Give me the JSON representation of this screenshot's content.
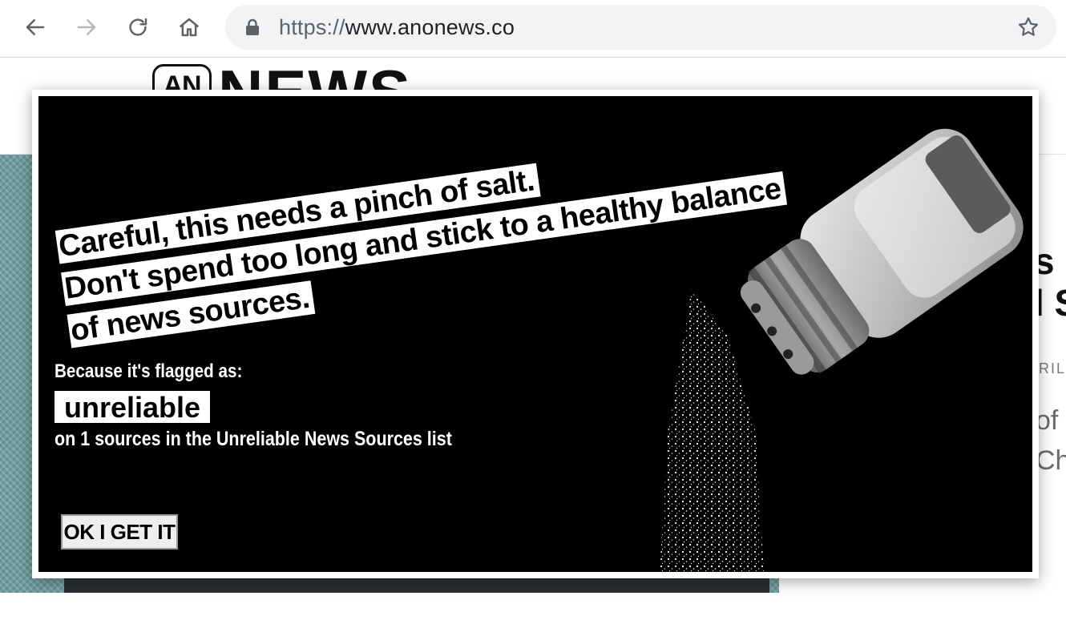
{
  "browser": {
    "url_scheme": "https://",
    "url_host": "www.anonews.co"
  },
  "site": {
    "logo_badge": "AN",
    "logo_word": "NEWS",
    "side_headline_line1": "s",
    "side_headline_line2": "l S",
    "side_date": "RIL",
    "side_summary_line1": "of",
    "side_summary_line2": "Ch"
  },
  "modal": {
    "headline_line1": "Careful, this needs a pinch of salt.",
    "headline_line2": "Don't spend too long and stick to a healthy balance",
    "headline_line3": "of news sources.",
    "flag_intro": "Because it's flagged as:",
    "flag_label": "unreliable",
    "flag_source": "on 1 sources in the Unreliable News Sources list",
    "ok_button": "OK I GET IT"
  },
  "icons": {
    "back": "arrow-left-icon",
    "forward": "arrow-right-icon",
    "reload": "reload-icon",
    "home": "home-icon",
    "lock": "lock-icon",
    "bookmark": "star-icon",
    "salt": "salt-shaker-icon"
  },
  "colors": {
    "modal_background": "#000000",
    "highlight": "#ffffff",
    "omnibox": "#f1f3f4",
    "hero": "#6f9ea1"
  }
}
